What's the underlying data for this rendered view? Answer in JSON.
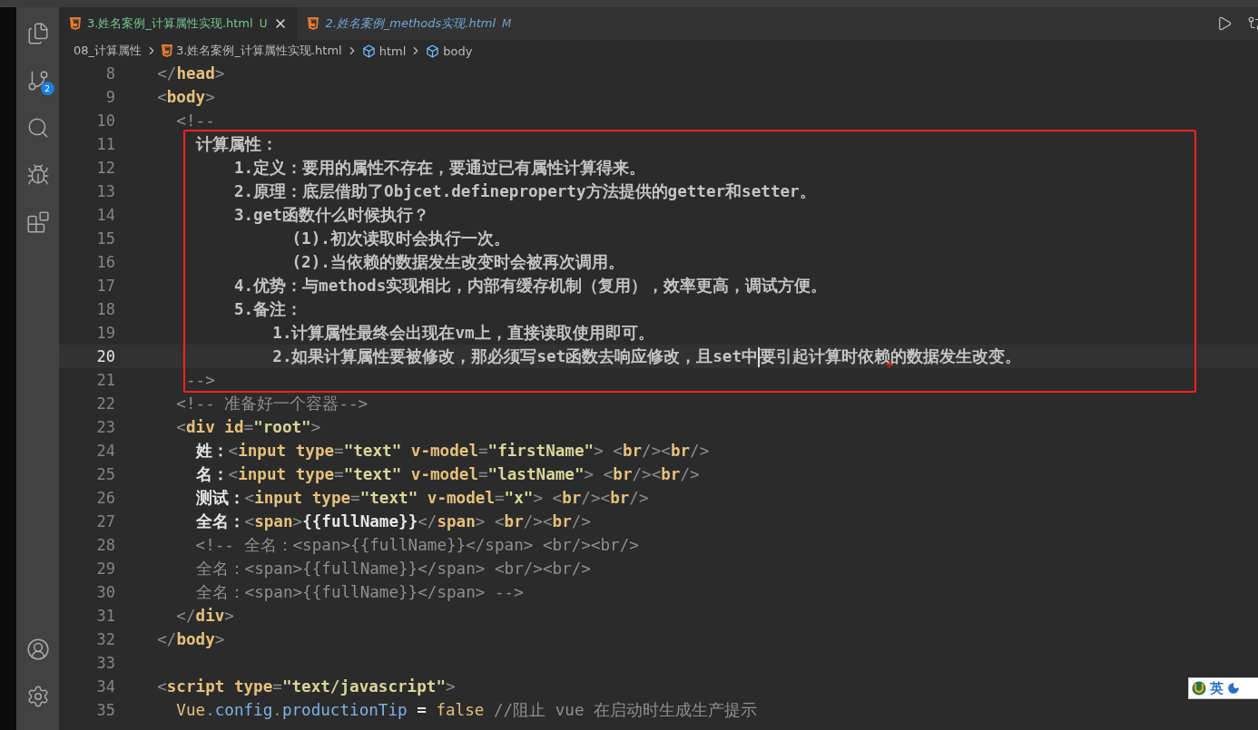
{
  "activity_bar": {
    "items": [
      {
        "kind": "explorer",
        "selected": false
      },
      {
        "kind": "source-control",
        "selected": false,
        "badge": "2"
      },
      {
        "kind": "search",
        "selected": false
      },
      {
        "kind": "run",
        "selected": false
      },
      {
        "kind": "extensions",
        "selected": false
      }
    ],
    "bottom": [
      {
        "kind": "account"
      },
      {
        "kind": "settings"
      }
    ]
  },
  "tabs": [
    {
      "label": "3.姓名案例_计算属性实现.html",
      "status": "U",
      "selected": true,
      "preview": false
    },
    {
      "label": "2.姓名案例_methods实现.html",
      "status": "M",
      "selected": false,
      "preview": true
    }
  ],
  "breadcrumb": [
    {
      "kind": "folder",
      "label": "08_计算属性"
    },
    {
      "kind": "file",
      "label": "3.姓名案例_计算属性实现.html"
    },
    {
      "kind": "element",
      "label": "html"
    },
    {
      "kind": "element",
      "label": "body"
    }
  ],
  "editor": {
    "lines": [
      {
        "number": "8",
        "current": false,
        "tokens": [
          {
            "kind": "punct",
            "text": "  </"
          },
          {
            "kind": "tag",
            "text": "head"
          },
          {
            "kind": "punct",
            "text": ">"
          }
        ]
      },
      {
        "number": "9",
        "current": false,
        "tokens": [
          {
            "kind": "punct",
            "text": "  <"
          },
          {
            "kind": "tag",
            "text": "body"
          },
          {
            "kind": "punct",
            "text": ">"
          }
        ]
      },
      {
        "number": "10",
        "current": false,
        "tokens": [
          {
            "kind": "comment",
            "text": "    <!--"
          }
        ]
      },
      {
        "number": "11",
        "current": false,
        "tokens": [
          {
            "kind": "note",
            "text": "      计算属性："
          }
        ]
      },
      {
        "number": "12",
        "current": false,
        "tokens": [
          {
            "kind": "note",
            "text": "          1.定义：要用的属性不存在，要通过已有属性计算得来。"
          }
        ]
      },
      {
        "number": "13",
        "current": false,
        "tokens": [
          {
            "kind": "note",
            "text": "          2.原理：底层借助了Objcet.defineproperty方法提供的getter和setter。"
          }
        ]
      },
      {
        "number": "14",
        "current": false,
        "tokens": [
          {
            "kind": "note",
            "text": "          3.get函数什么时候执行？"
          }
        ]
      },
      {
        "number": "15",
        "current": false,
        "tokens": [
          {
            "kind": "note",
            "text": "                (1).初次读取时会执行一次。"
          }
        ]
      },
      {
        "number": "16",
        "current": false,
        "tokens": [
          {
            "kind": "note",
            "text": "                (2).当依赖的数据发生改变时会被再次调用。"
          }
        ]
      },
      {
        "number": "17",
        "current": false,
        "tokens": [
          {
            "kind": "note",
            "text": "          4.优势：与methods实现相比，内部有缓存机制（复用），效率更高，调试方便。"
          }
        ]
      },
      {
        "number": "18",
        "current": false,
        "tokens": [
          {
            "kind": "note",
            "text": "          5.备注："
          }
        ]
      },
      {
        "number": "19",
        "current": false,
        "tokens": [
          {
            "kind": "note",
            "text": "              1.计算属性最终会出现在vm上，直接读取使用即可。"
          }
        ]
      },
      {
        "number": "20",
        "current": true,
        "tokens": [
          {
            "kind": "note",
            "text": "              2.如果计算属性要被修改，那必须写set函数去响应修改，且set中"
          },
          {
            "kind": "caret"
          },
          {
            "kind": "note",
            "text": "要引起计算时依赖的数据发生改变。"
          }
        ]
      },
      {
        "number": "21",
        "current": false,
        "tokens": [
          {
            "kind": "comment",
            "text": "     -->"
          }
        ]
      },
      {
        "number": "22",
        "current": false,
        "tokens": [
          {
            "kind": "comment",
            "text": "    <!-- 准备好一个容器-->"
          }
        ]
      },
      {
        "number": "23",
        "current": false,
        "tokens": [
          {
            "kind": "punct",
            "text": "    <"
          },
          {
            "kind": "tag",
            "text": "div"
          },
          {
            "kind": "attr",
            "text": " id"
          },
          {
            "kind": "punct",
            "text": "="
          },
          {
            "kind": "string",
            "text": "\"root\""
          },
          {
            "kind": "punct",
            "text": ">"
          }
        ]
      },
      {
        "number": "24",
        "current": false,
        "tokens": [
          {
            "kind": "text",
            "text": "      姓："
          },
          {
            "kind": "punct",
            "text": "<"
          },
          {
            "kind": "tag",
            "text": "input"
          },
          {
            "kind": "attr",
            "text": " type"
          },
          {
            "kind": "punct",
            "text": "="
          },
          {
            "kind": "string",
            "text": "\"text\""
          },
          {
            "kind": "attr",
            "text": " v-model"
          },
          {
            "kind": "punct",
            "text": "="
          },
          {
            "kind": "string",
            "text": "\"firstName\""
          },
          {
            "kind": "punct",
            "text": "> <"
          },
          {
            "kind": "tag",
            "text": "br"
          },
          {
            "kind": "punct",
            "text": "/><"
          },
          {
            "kind": "tag",
            "text": "br"
          },
          {
            "kind": "punct",
            "text": "/>"
          }
        ]
      },
      {
        "number": "25",
        "current": false,
        "tokens": [
          {
            "kind": "text",
            "text": "      名："
          },
          {
            "kind": "punct",
            "text": "<"
          },
          {
            "kind": "tag",
            "text": "input"
          },
          {
            "kind": "attr",
            "text": " type"
          },
          {
            "kind": "punct",
            "text": "="
          },
          {
            "kind": "string",
            "text": "\"text\""
          },
          {
            "kind": "attr",
            "text": " v-model"
          },
          {
            "kind": "punct",
            "text": "="
          },
          {
            "kind": "string",
            "text": "\"lastName\""
          },
          {
            "kind": "punct",
            "text": "> <"
          },
          {
            "kind": "tag",
            "text": "br"
          },
          {
            "kind": "punct",
            "text": "/><"
          },
          {
            "kind": "tag",
            "text": "br"
          },
          {
            "kind": "punct",
            "text": "/>"
          }
        ]
      },
      {
        "number": "26",
        "current": false,
        "tokens": [
          {
            "kind": "text",
            "text": "      测试："
          },
          {
            "kind": "punct",
            "text": "<"
          },
          {
            "kind": "tag",
            "text": "input"
          },
          {
            "kind": "attr",
            "text": " type"
          },
          {
            "kind": "punct",
            "text": "="
          },
          {
            "kind": "string",
            "text": "\"text\""
          },
          {
            "kind": "attr",
            "text": " v-model"
          },
          {
            "kind": "punct",
            "text": "="
          },
          {
            "kind": "string",
            "text": "\"x\""
          },
          {
            "kind": "punct",
            "text": "> <"
          },
          {
            "kind": "tag",
            "text": "br"
          },
          {
            "kind": "punct",
            "text": "/><"
          },
          {
            "kind": "tag",
            "text": "br"
          },
          {
            "kind": "punct",
            "text": "/>"
          }
        ]
      },
      {
        "number": "27",
        "current": false,
        "tokens": [
          {
            "kind": "text",
            "text": "      全名："
          },
          {
            "kind": "punct",
            "text": "<"
          },
          {
            "kind": "tag",
            "text": "span"
          },
          {
            "kind": "punct",
            "text": ">"
          },
          {
            "kind": "text",
            "text": "{{fullName}}"
          },
          {
            "kind": "punct",
            "text": "</"
          },
          {
            "kind": "tag",
            "text": "span"
          },
          {
            "kind": "punct",
            "text": "> <"
          },
          {
            "kind": "tag",
            "text": "br"
          },
          {
            "kind": "punct",
            "text": "/><"
          },
          {
            "kind": "tag",
            "text": "br"
          },
          {
            "kind": "punct",
            "text": "/>"
          }
        ]
      },
      {
        "number": "28",
        "current": false,
        "tokens": [
          {
            "kind": "comment",
            "text": "      <!-- 全名：<span>{{fullName}}</span> <br/><br/>"
          }
        ]
      },
      {
        "number": "29",
        "current": false,
        "tokens": [
          {
            "kind": "comment",
            "text": "      全名：<span>{{fullName}}</span> <br/><br/>"
          }
        ]
      },
      {
        "number": "30",
        "current": false,
        "tokens": [
          {
            "kind": "comment",
            "text": "      全名：<span>{{fullName}}</span> -->"
          }
        ]
      },
      {
        "number": "31",
        "current": false,
        "tokens": [
          {
            "kind": "punct",
            "text": "    </"
          },
          {
            "kind": "tag",
            "text": "div"
          },
          {
            "kind": "punct",
            "text": ">"
          }
        ]
      },
      {
        "number": "32",
        "current": false,
        "tokens": [
          {
            "kind": "punct",
            "text": "  </"
          },
          {
            "kind": "tag",
            "text": "body"
          },
          {
            "kind": "punct",
            "text": ">"
          }
        ]
      },
      {
        "number": "33",
        "current": false
      },
      {
        "number": "34",
        "current": false,
        "tokens": [
          {
            "kind": "punct",
            "text": "  <"
          },
          {
            "kind": "tag",
            "text": "script"
          },
          {
            "kind": "attr",
            "text": " type"
          },
          {
            "kind": "punct",
            "text": "="
          },
          {
            "kind": "string",
            "text": "\"text/javascript\""
          },
          {
            "kind": "punct",
            "text": ">"
          }
        ]
      },
      {
        "number": "35",
        "current": false,
        "tokens": [
          {
            "kind": "object",
            "text": "    Vue"
          },
          {
            "kind": "punct",
            "text": "."
          },
          {
            "kind": "property",
            "text": "config"
          },
          {
            "kind": "punct",
            "text": "."
          },
          {
            "kind": "property",
            "text": "productionTip"
          },
          {
            "kind": "text",
            "text": " = "
          },
          {
            "kind": "keyword",
            "text": "false"
          },
          {
            "kind": "comment",
            "text": " //阻止 vue 在启动时生成生产提示"
          }
        ]
      }
    ]
  },
  "ime_widget": {
    "mode": "英"
  }
}
